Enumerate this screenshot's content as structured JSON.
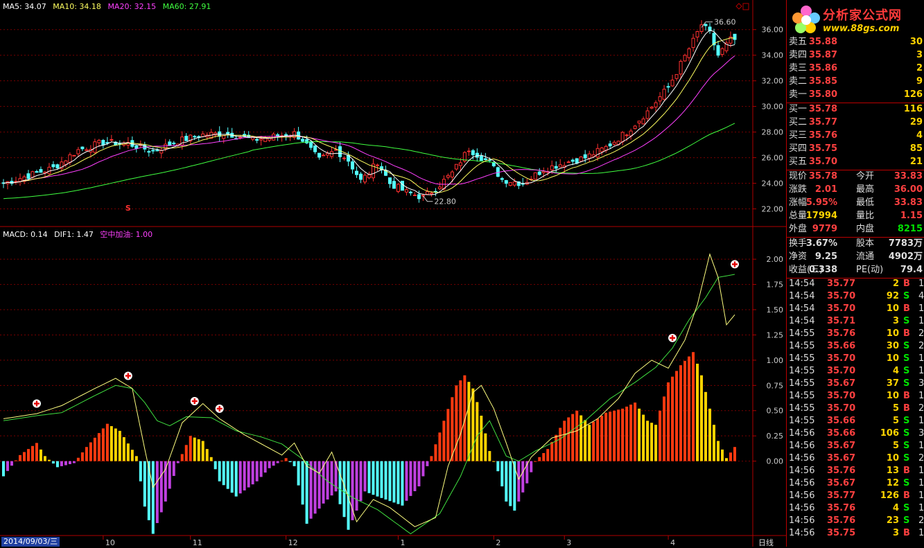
{
  "colors": {
    "up": "#ff3030",
    "down": "#54ffff",
    "ma5": "#ffffff",
    "ma10": "#ffff60",
    "ma20": "#ff40ff",
    "ma60": "#40ff40",
    "grid": "#7a0000",
    "macd_pos1": "#ff3a10",
    "macd_pos2": "#ffd400",
    "macd_neg1": "#54ffff",
    "macd_neg2": "#c040e0"
  },
  "legend_main": {
    "ma5": "MA5: 34.07",
    "ma10": "MA10: 34.18",
    "ma20": "MA20: 32.15",
    "ma60": "MA60: 27.91"
  },
  "legend_sub": {
    "macd": "MACD: 0.14",
    "dif": "DIF1: 1.47",
    "signal": "空中加油: 1.00"
  },
  "annotations": {
    "high": "36.60",
    "low": "22.80",
    "s_marker": "S"
  },
  "date_label": "2014/09/03/三",
  "period_label": "日线",
  "chart_data": [
    {
      "type": "candlestick",
      "ylim": [
        21.0,
        37.5
      ],
      "yticks": [
        "22.00",
        "24.00",
        "26.00",
        "28.00",
        "30.00",
        "32.00",
        "34.00",
        "36.00"
      ],
      "xticks": [
        "10",
        "11",
        "12",
        "1",
        "2",
        "3",
        "4"
      ],
      "xtick_index": [
        24,
        45,
        68,
        95,
        118,
        135,
        160
      ],
      "series_ma": [
        "MA5",
        "MA10",
        "MA20",
        "MA60"
      ],
      "anchors": [
        [
          0,
          24.0
        ],
        [
          6,
          24.6
        ],
        [
          12,
          25.2
        ],
        [
          18,
          26.6
        ],
        [
          24,
          27.2
        ],
        [
          30,
          27.1
        ],
        [
          36,
          26.5
        ],
        [
          42,
          27.3
        ],
        [
          48,
          27.8
        ],
        [
          54,
          27.9
        ],
        [
          60,
          27.4
        ],
        [
          66,
          27.7
        ],
        [
          70,
          27.9
        ],
        [
          72,
          27.4
        ],
        [
          76,
          25.8
        ],
        [
          80,
          26.6
        ],
        [
          83,
          25.8
        ],
        [
          86,
          24.2
        ],
        [
          88,
          24.8
        ],
        [
          90,
          25.7
        ],
        [
          93,
          24.0
        ],
        [
          97,
          23.3
        ],
        [
          101,
          22.9
        ],
        [
          104,
          23.6
        ],
        [
          108,
          24.8
        ],
        [
          112,
          26.7
        ],
        [
          117,
          25.6
        ],
        [
          120,
          24.3
        ],
        [
          125,
          24.0
        ],
        [
          130,
          25.1
        ],
        [
          135,
          25.6
        ],
        [
          140,
          26.0
        ],
        [
          145,
          26.8
        ],
        [
          150,
          28.0
        ],
        [
          155,
          29.6
        ],
        [
          160,
          31.5
        ],
        [
          163,
          33.3
        ],
        [
          166,
          35.1
        ],
        [
          168,
          36.4
        ],
        [
          170,
          35.7
        ],
        [
          172,
          34.0
        ],
        [
          175,
          35.2
        ]
      ],
      "last": {
        "MA5": 34.07,
        "MA10": 34.18,
        "MA20": 32.15,
        "MA60": 27.91
      }
    },
    {
      "type": "macd",
      "ylim": [
        -0.73,
        2.2
      ],
      "yticks": [
        "0.00",
        "0.25",
        "0.50",
        "0.75",
        "1.00",
        "1.25",
        "1.50",
        "1.75",
        "2.00"
      ],
      "dif_anchors": [
        [
          0,
          0.42
        ],
        [
          8,
          0.47
        ],
        [
          14,
          0.55
        ],
        [
          22,
          0.72
        ],
        [
          27,
          0.82
        ],
        [
          31,
          0.72
        ],
        [
          34,
          0.12
        ],
        [
          36,
          -0.26
        ],
        [
          39,
          -0.08
        ],
        [
          43,
          0.38
        ],
        [
          48,
          0.57
        ],
        [
          52,
          0.42
        ],
        [
          58,
          0.26
        ],
        [
          63,
          0.15
        ],
        [
          67,
          0.06
        ],
        [
          70,
          0.18
        ],
        [
          73,
          -0.05
        ],
        [
          76,
          -0.12
        ],
        [
          79,
          0.09
        ],
        [
          82,
          -0.24
        ],
        [
          85,
          -0.6
        ],
        [
          89,
          -0.38
        ],
        [
          93,
          -0.46
        ],
        [
          99,
          -0.65
        ],
        [
          104,
          -0.56
        ],
        [
          107,
          -0.05
        ],
        [
          110,
          0.27
        ],
        [
          113,
          0.68
        ],
        [
          115,
          0.75
        ],
        [
          118,
          0.52
        ],
        [
          121,
          0.18
        ],
        [
          124,
          -0.18
        ],
        [
          127,
          0.04
        ],
        [
          132,
          0.23
        ],
        [
          138,
          0.3
        ],
        [
          143,
          0.42
        ],
        [
          148,
          0.62
        ],
        [
          152,
          0.87
        ],
        [
          156,
          1.0
        ],
        [
          160,
          0.92
        ],
        [
          164,
          1.2
        ],
        [
          167,
          1.55
        ],
        [
          170,
          2.05
        ],
        [
          172,
          1.82
        ],
        [
          174,
          1.35
        ],
        [
          176,
          1.45
        ]
      ],
      "signal_anchors": [
        [
          0,
          0.4
        ],
        [
          8,
          0.45
        ],
        [
          14,
          0.48
        ],
        [
          22,
          0.65
        ],
        [
          27,
          0.75
        ],
        [
          31,
          0.72
        ],
        [
          34,
          0.58
        ],
        [
          37,
          0.4
        ],
        [
          40,
          0.35
        ],
        [
          44,
          0.44
        ],
        [
          50,
          0.43
        ],
        [
          56,
          0.3
        ],
        [
          62,
          0.24
        ],
        [
          67,
          0.17
        ],
        [
          72,
          0.02
        ],
        [
          78,
          -0.2
        ],
        [
          84,
          -0.36
        ],
        [
          90,
          -0.48
        ],
        [
          98,
          -0.72
        ],
        [
          105,
          -0.52
        ],
        [
          110,
          -0.15
        ],
        [
          114,
          0.25
        ],
        [
          117,
          0.4
        ],
        [
          121,
          0.05
        ],
        [
          124,
          0.0
        ],
        [
          128,
          0.1
        ],
        [
          134,
          0.22
        ],
        [
          140,
          0.4
        ],
        [
          146,
          0.62
        ],
        [
          152,
          0.78
        ],
        [
          157,
          0.93
        ],
        [
          161,
          1.12
        ],
        [
          165,
          1.4
        ],
        [
          169,
          1.62
        ],
        [
          172,
          1.82
        ],
        [
          176,
          1.85
        ]
      ],
      "hist_anchors": [
        [
          0,
          -0.15
        ],
        [
          4,
          0.06
        ],
        [
          8,
          0.18
        ],
        [
          10,
          0.05
        ],
        [
          13,
          -0.06
        ],
        [
          17,
          -0.02
        ],
        [
          20,
          0.14
        ],
        [
          25,
          0.37
        ],
        [
          28,
          0.3
        ],
        [
          32,
          0.05
        ],
        [
          34,
          -0.45
        ],
        [
          36,
          -0.72
        ],
        [
          39,
          -0.4
        ],
        [
          42,
          -0.02
        ],
        [
          45,
          0.25
        ],
        [
          48,
          0.2
        ],
        [
          50,
          0.04
        ],
        [
          52,
          -0.2
        ],
        [
          56,
          -0.35
        ],
        [
          61,
          -0.2
        ],
        [
          64,
          -0.07
        ],
        [
          68,
          0.03
        ],
        [
          70,
          -0.05
        ],
        [
          73,
          -0.62
        ],
        [
          77,
          -0.42
        ],
        [
          80,
          -0.3
        ],
        [
          83,
          -0.68
        ],
        [
          87,
          -0.3
        ],
        [
          90,
          -0.35
        ],
        [
          96,
          -0.44
        ],
        [
          100,
          -0.25
        ],
        [
          103,
          0.05
        ],
        [
          106,
          0.4
        ],
        [
          109,
          0.75
        ],
        [
          111,
          0.85
        ],
        [
          113,
          0.72
        ],
        [
          115,
          0.45
        ],
        [
          117,
          0.1
        ],
        [
          119,
          -0.1
        ],
        [
          121,
          -0.4
        ],
        [
          123,
          -0.49
        ],
        [
          126,
          -0.22
        ],
        [
          128,
          0.0
        ],
        [
          131,
          0.12
        ],
        [
          135,
          0.4
        ],
        [
          138,
          0.5
        ],
        [
          141,
          0.36
        ],
        [
          145,
          0.48
        ],
        [
          149,
          0.52
        ],
        [
          152,
          0.58
        ],
        [
          155,
          0.4
        ],
        [
          157,
          0.36
        ],
        [
          160,
          0.78
        ],
        [
          163,
          0.95
        ],
        [
          166,
          1.08
        ],
        [
          168,
          0.85
        ],
        [
          170,
          0.52
        ],
        [
          172,
          0.2
        ],
        [
          174,
          0.03
        ],
        [
          176,
          0.14
        ]
      ],
      "signal_markers": [
        8,
        30,
        46,
        52,
        161,
        176
      ]
    }
  ],
  "quote": {
    "asks": [
      {
        "label": "卖五",
        "price": "35.88",
        "vol": "30"
      },
      {
        "label": "卖四",
        "price": "35.87",
        "vol": "3"
      },
      {
        "label": "卖三",
        "price": "35.86",
        "vol": "2"
      },
      {
        "label": "卖二",
        "price": "35.85",
        "vol": "9"
      },
      {
        "label": "卖一",
        "price": "35.80",
        "vol": "126"
      }
    ],
    "bids": [
      {
        "label": "买一",
        "price": "35.78",
        "vol": "116"
      },
      {
        "label": "买二",
        "price": "35.77",
        "vol": "29"
      },
      {
        "label": "买三",
        "price": "35.76",
        "vol": "4"
      },
      {
        "label": "买四",
        "price": "35.75",
        "vol": "85"
      },
      {
        "label": "买五",
        "price": "35.70",
        "vol": "21"
      }
    ],
    "stats1": [
      {
        "l1": "现价",
        "v1": "35.78",
        "c1": "red",
        "l2": "今开",
        "v2": "33.83",
        "c2": "red"
      },
      {
        "l1": "涨跌",
        "v1": "2.01",
        "c1": "red",
        "l2": "最高",
        "v2": "36.00",
        "c2": "red"
      },
      {
        "l1": "涨幅",
        "v1": "5.95%",
        "c1": "red",
        "l2": "最低",
        "v2": "33.83",
        "c2": "red"
      },
      {
        "l1": "总量",
        "v1": "17994",
        "c1": "yellow",
        "l2": "量比",
        "v2": "1.15",
        "c2": "red"
      },
      {
        "l1": "外盘",
        "v1": "9779",
        "c1": "red",
        "l2": "内盘",
        "v2": "8215",
        "c2": "green"
      }
    ],
    "stats2": [
      {
        "l1": "换手",
        "v1": "3.67%",
        "c1": "white",
        "l2": "股本",
        "v2": "7783万",
        "c2": "white"
      },
      {
        "l1": "净资",
        "v1": "9.25",
        "c1": "white",
        "l2": "流通",
        "v2": "4902万",
        "c2": "white"
      },
      {
        "l1": "收益(三)",
        "v1": "0.338",
        "c1": "white",
        "l2": "PE(动)",
        "v2": "79.4",
        "c2": "white"
      }
    ],
    "ticks": [
      {
        "t": "14:54",
        "p": "35.77",
        "v": "2",
        "bs": "B",
        "n": "1"
      },
      {
        "t": "14:54",
        "p": "35.70",
        "v": "92",
        "bs": "S",
        "n": "4"
      },
      {
        "t": "14:54",
        "p": "35.70",
        "v": "10",
        "bs": "B",
        "n": "1"
      },
      {
        "t": "14:54",
        "p": "35.71",
        "v": "3",
        "bs": "S",
        "n": "1"
      },
      {
        "t": "14:55",
        "p": "35.76",
        "v": "10",
        "bs": "B",
        "n": "2"
      },
      {
        "t": "14:55",
        "p": "35.66",
        "v": "30",
        "bs": "S",
        "n": "2"
      },
      {
        "t": "14:55",
        "p": "35.70",
        "v": "10",
        "bs": "S",
        "n": "1"
      },
      {
        "t": "14:55",
        "p": "35.70",
        "v": "4",
        "bs": "S",
        "n": "1"
      },
      {
        "t": "14:55",
        "p": "35.67",
        "v": "37",
        "bs": "S",
        "n": "3"
      },
      {
        "t": "14:55",
        "p": "35.70",
        "v": "10",
        "bs": "B",
        "n": "1"
      },
      {
        "t": "14:55",
        "p": "35.70",
        "v": "5",
        "bs": "B",
        "n": "2"
      },
      {
        "t": "14:55",
        "p": "35.66",
        "v": "5",
        "bs": "S",
        "n": "1"
      },
      {
        "t": "14:56",
        "p": "35.66",
        "v": "106",
        "bs": "S",
        "n": "3"
      },
      {
        "t": "14:56",
        "p": "35.67",
        "v": "5",
        "bs": "S",
        "n": "1"
      },
      {
        "t": "14:56",
        "p": "35.67",
        "v": "10",
        "bs": "S",
        "n": "2"
      },
      {
        "t": "14:56",
        "p": "35.76",
        "v": "13",
        "bs": "B",
        "n": "1"
      },
      {
        "t": "14:56",
        "p": "35.67",
        "v": "12",
        "bs": "S",
        "n": "1"
      },
      {
        "t": "14:56",
        "p": "35.77",
        "v": "126",
        "bs": "B",
        "n": "1"
      },
      {
        "t": "14:56",
        "p": "35.76",
        "v": "4",
        "bs": "S",
        "n": "1"
      },
      {
        "t": "14:56",
        "p": "35.76",
        "v": "23",
        "bs": "S",
        "n": "2"
      },
      {
        "t": "14:56",
        "p": "35.75",
        "v": "3",
        "bs": "B",
        "n": "1"
      }
    ]
  },
  "logo": {
    "brand": "分析家公式网",
    "site": "www.88gs.com"
  }
}
